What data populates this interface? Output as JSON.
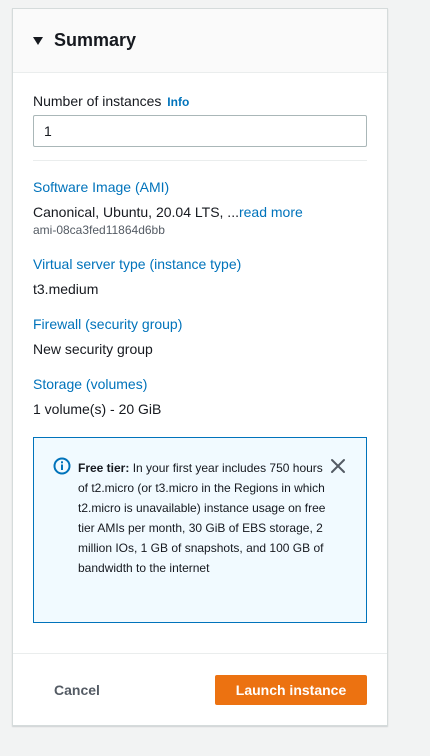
{
  "summary": {
    "title": "Summary",
    "instances": {
      "label": "Number of instances",
      "info_label": "Info",
      "value": "1"
    },
    "software_image": {
      "title": "Software Image (AMI)",
      "value": "Canonical, Ubuntu, 20.04 LTS, ...",
      "read_more": "read more",
      "ami_id": "ami-08ca3fed11864d6bb"
    },
    "instance_type": {
      "title": "Virtual server type (instance type)",
      "value": "t3.medium"
    },
    "firewall": {
      "title": "Firewall (security group)",
      "value": "New security group"
    },
    "storage": {
      "title": "Storage (volumes)",
      "value": "1 volume(s) - 20 GiB"
    },
    "free_tier_alert": {
      "heading": "Free tier:",
      "body": " In your first year includes 750 hours of t2.micro (or t3.micro in the Regions in which t2.micro is unavailable) instance usage on free tier AMIs per month, 30 GiB of EBS storage, 2 million IOs, 1 GB of snapshots, and 100 GB of bandwidth to the internet",
      "icon": "info-circle-icon"
    },
    "footer": {
      "cancel_label": "Cancel",
      "launch_label": "Launch instance"
    }
  },
  "colors": {
    "link": "#0073bb",
    "primary_button": "#ec7211",
    "alert_background": "#f1faff",
    "alert_border": "#0073bb"
  }
}
